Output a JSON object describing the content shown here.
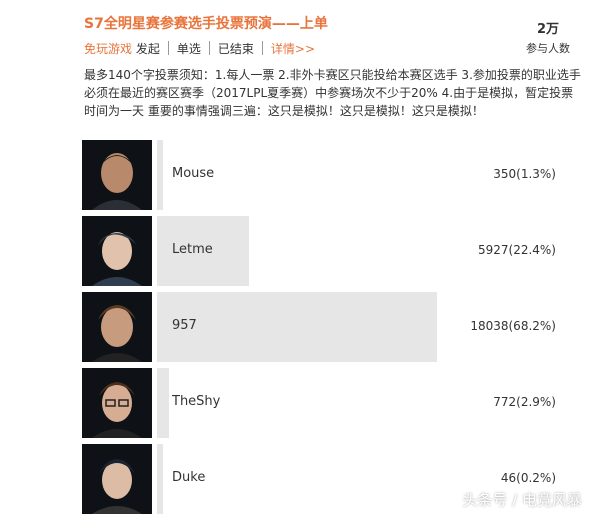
{
  "poll": {
    "title": "S7全明星赛参赛选手投票预演——上单",
    "publisher": "免玩游戏",
    "publisher_suffix": "发起",
    "type": "单选",
    "status": "已结束",
    "details_link": "详情>>",
    "participants_count": "2万",
    "participants_label": "参与人数",
    "description": "最多140个字投票须知：1.每人一票 2.非外卡赛区只能投给本赛区选手 3.参加投票的职业选手必须在最近的赛区赛季（2017LPL夏季赛）中参赛场次不少于20% 4.由于是模拟，暂定投票时间为一天 重要的事情强调三遍：这只是模拟！这只是模拟！这只是模拟！"
  },
  "options": [
    {
      "name": "Mouse",
      "result": "350(1.3%)",
      "share": 1.3
    },
    {
      "name": "Letme",
      "result": "5927(22.4%)",
      "share": 22.4
    },
    {
      "name": "957",
      "result": "18038(68.2%)",
      "share": 68.2
    },
    {
      "name": "TheShy",
      "result": "772(2.9%)",
      "share": 2.9
    },
    {
      "name": "Duke",
      "result": "46(0.2%)",
      "share": 0.2
    }
  ],
  "watermark": "头条号 / 电竞风暴",
  "colors": {
    "accent": "#e8743b",
    "bar": "#e6e6e6"
  }
}
